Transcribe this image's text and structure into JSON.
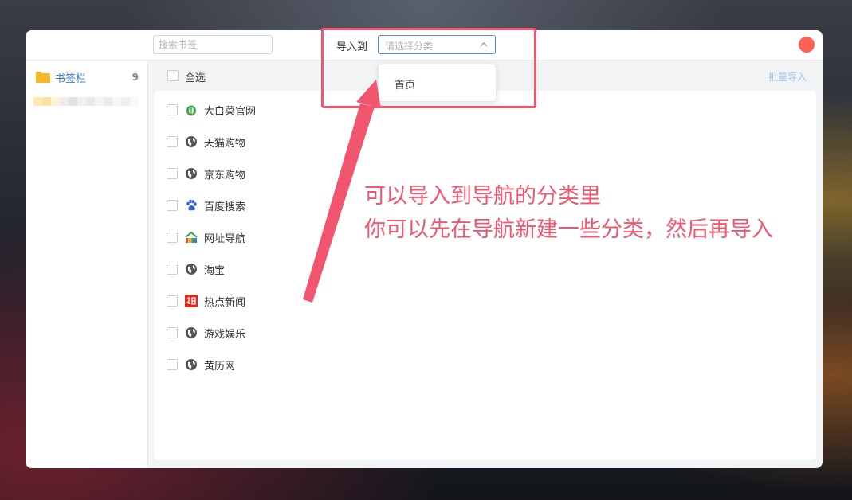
{
  "topbar": {
    "search_placeholder": "搜索书签",
    "import_label": "导入到",
    "category_placeholder": "请选择分类"
  },
  "sidebar": {
    "folder_label": "书签栏",
    "folder_count": "9"
  },
  "main": {
    "select_all_label": "全选",
    "batch_import_label": "批量导入",
    "bookmarks": [
      {
        "label": "大白菜官网",
        "icon": "cabbage-icon"
      },
      {
        "label": "天猫购物",
        "icon": "globe-icon"
      },
      {
        "label": "京东购物",
        "icon": "globe-icon"
      },
      {
        "label": "百度搜索",
        "icon": "baidu-paw-icon"
      },
      {
        "label": "网址导航",
        "icon": "2345-icon"
      },
      {
        "label": "淘宝",
        "icon": "globe-icon"
      },
      {
        "label": "热点新闻",
        "icon": "news-red-icon"
      },
      {
        "label": "游戏娱乐",
        "icon": "globe-icon"
      },
      {
        "label": "黄历网",
        "icon": "globe-icon"
      }
    ]
  },
  "dropdown": {
    "options": [
      "首页"
    ]
  },
  "annotation": {
    "line1": "可以导入到导航的分类里",
    "line2": "你可以先在导航新建一些分类，然后再导入"
  },
  "colors": {
    "accent": "#3a7bd5",
    "annotation": "#f2566f",
    "close": "#ff5f57",
    "folder": "#f7b928"
  }
}
